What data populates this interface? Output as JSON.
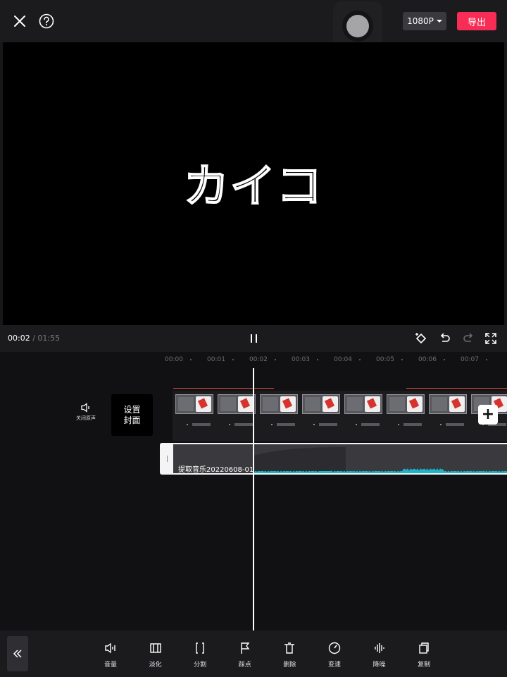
{
  "topbar": {
    "resolution": "1080P",
    "export_label": "导出"
  },
  "preview": {
    "title_text": "カイコ"
  },
  "playback": {
    "current_time": "00:02",
    "separator": "/",
    "total_time": "01:55"
  },
  "timeline": {
    "ruler": [
      "00:00",
      "00:01",
      "00:02",
      "00:03",
      "00:04",
      "00:05",
      "00:06",
      "00:07"
    ],
    "mute_label": "关闭原声",
    "cover_label": "设置\n封面",
    "audio_clip_name": "提取音乐20220608-01",
    "waveform_color": "#1fb5c9"
  },
  "toolbar": {
    "items": [
      {
        "label": "音量",
        "icon": "volume-icon"
      },
      {
        "label": "淡化",
        "icon": "fade-icon"
      },
      {
        "label": "分割",
        "icon": "split-icon"
      },
      {
        "label": "踩点",
        "icon": "flag-icon"
      },
      {
        "label": "删除",
        "icon": "delete-icon"
      },
      {
        "label": "变速",
        "icon": "speed-icon"
      },
      {
        "label": "降噪",
        "icon": "noise-reduction-icon"
      },
      {
        "label": "复制",
        "icon": "copy-icon"
      }
    ]
  },
  "colors": {
    "accent": "#f72d55",
    "background": "#17171a",
    "clip_marker": "#e0553b"
  }
}
